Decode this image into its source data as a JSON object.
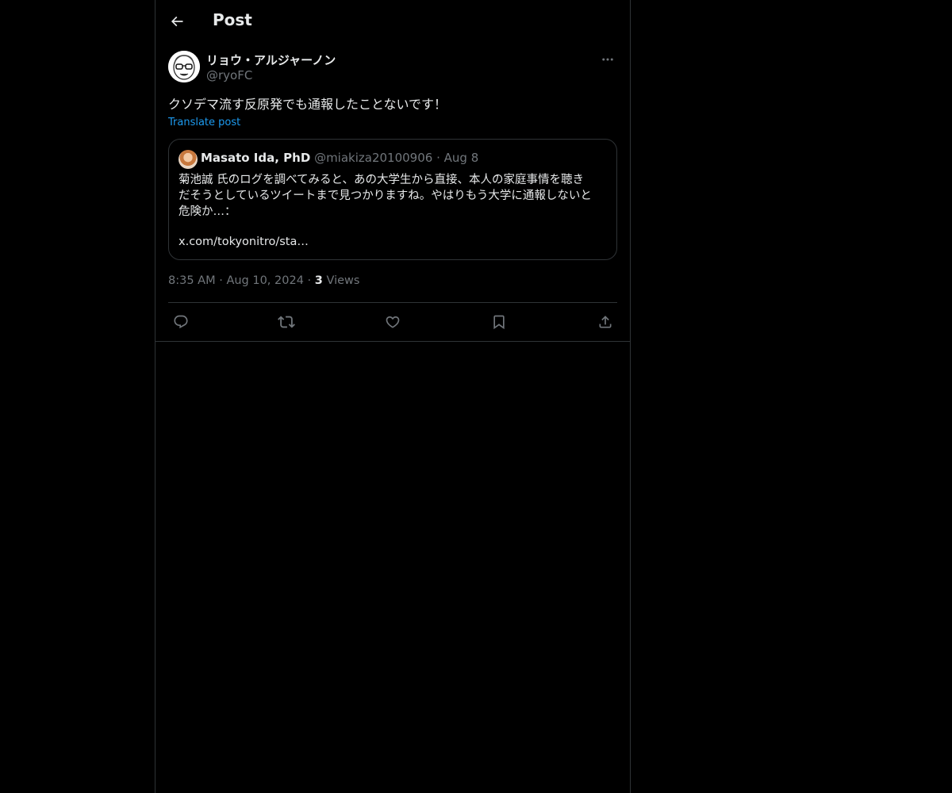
{
  "header": {
    "title": "Post"
  },
  "post": {
    "author_name": "リョウ・アルジャーノン",
    "author_handle": "@ryoFC",
    "text": "クソデマ流す反原発でも通報したことないです！",
    "translate_label": "Translate post",
    "quote": {
      "author_name": "Masato Ida, PhD",
      "author_handle": "@miakiza20100906",
      "separator": "·",
      "date": "Aug 8",
      "text_lines": [
        "菊池誠 氏のログを調べてみると、あの大学生から直接、本人の家庭事情を聴き",
        "だそうとしているツイートまで見つかりますね。やはりもう大学に通報しないと",
        "危険か…："
      ],
      "link": "x.com/tokyonitro/sta…"
    },
    "time": "8:35 AM",
    "date": "Aug 10, 2024",
    "separator": "·",
    "views_count": "3",
    "views_label": "Views"
  },
  "icons": {
    "back": "arrow-left-icon",
    "more": "more-horizontal-icon",
    "reply": "reply-icon",
    "repost": "repost-icon",
    "like": "heart-icon",
    "bookmark": "bookmark-icon",
    "share": "share-icon"
  },
  "colors": {
    "background": "#000000",
    "text": "#e7e9ea",
    "muted": "#71767b",
    "accent": "#1d9bf0",
    "border": "#2f3336"
  }
}
